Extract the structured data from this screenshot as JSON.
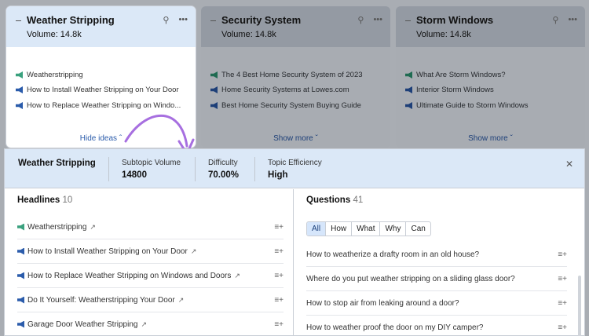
{
  "cards": [
    {
      "title": "Weather Stripping",
      "volume": "Volume: 14.8k",
      "ideas": [
        "Weatherstripping",
        "How to Install Weather Stripping on Your Door",
        "How to Replace Weather Stripping on Windo..."
      ],
      "toggle": "Hide ideas"
    },
    {
      "title": "Security System",
      "volume": "Volume: 14.8k",
      "ideas": [
        "The 4 Best Home Security System of 2023",
        "Home Security Systems at Lowes.com",
        "Best Home Security System Buying Guide"
      ],
      "toggle": "Show more"
    },
    {
      "title": "Storm Windows",
      "volume": "Volume: 14.8k",
      "ideas": [
        "What Are Storm Windows?",
        "Interior Storm Windows",
        "Ultimate Guide to Storm Windows"
      ],
      "toggle": "Show more"
    }
  ],
  "panel": {
    "topic": "Weather Stripping",
    "stats": [
      {
        "label": "Subtopic Volume",
        "value": "14800"
      },
      {
        "label": "Difficulty",
        "value": "70.00%"
      },
      {
        "label": "Topic Efficiency",
        "value": "High"
      }
    ],
    "headlines": {
      "title": "Headlines",
      "count": "10",
      "items": [
        "Weatherstripping",
        "How to Install Weather Stripping on Your Door",
        "How to Replace Weather Stripping on Windows and Doors",
        "Do It Yourself: Weatherstripping Your Door",
        "Garage Door Weather Stripping"
      ]
    },
    "questions": {
      "title": "Questions",
      "count": "41",
      "filters": [
        "All",
        "How",
        "What",
        "Why",
        "Can"
      ],
      "items": [
        "How to weatherize a drafty room in an old house?",
        "Where do you put weather stripping on a sliding glass door?",
        "How to stop air from leaking around a door?",
        "How to weather proof the door on my DIY camper?"
      ]
    }
  },
  "colors": {
    "megaphone_green": "#3aa17e",
    "megaphone_blue": "#2b5cab",
    "arrow": "#a76fe0"
  }
}
